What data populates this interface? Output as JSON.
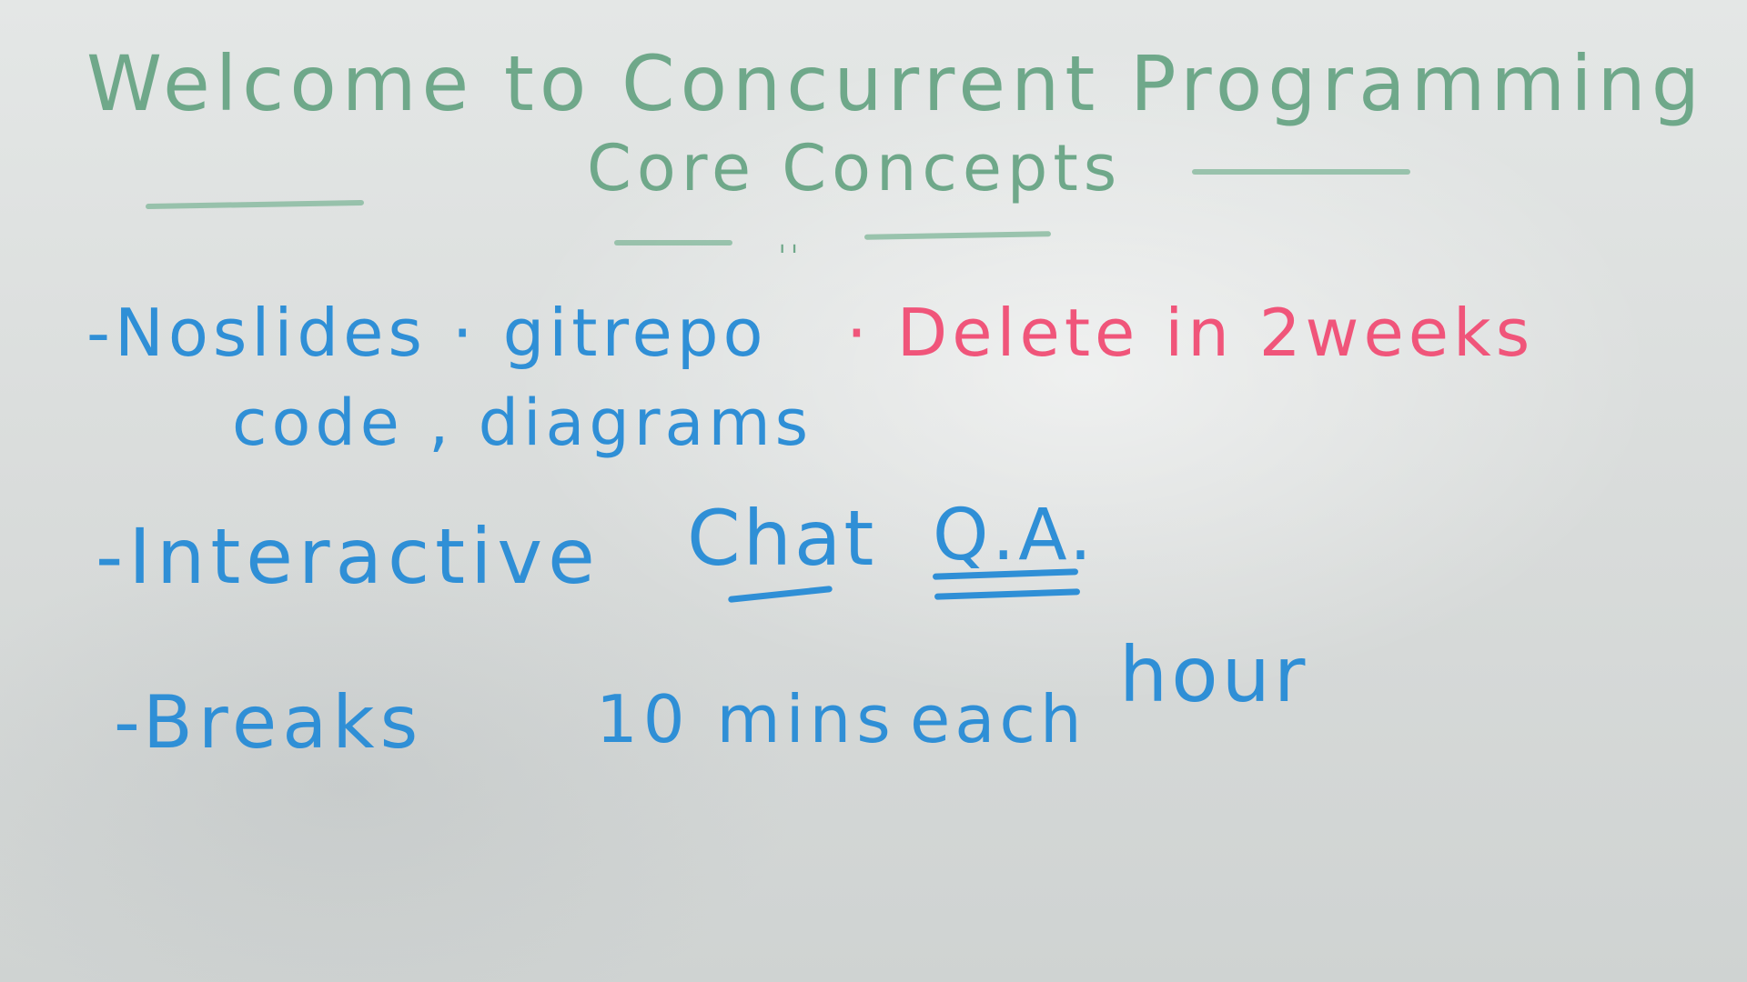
{
  "whiteboard": {
    "title_line1": "Welcome to Concurrent Programming",
    "title_line2": "Core Concepts",
    "title_marks": "ˌˌ",
    "items": [
      {
        "part1": "-Noslides · gitrepo",
        "part2": "· Delete in 2weeks",
        "part3": "code , diagrams"
      },
      {
        "part1": "-Interactive",
        "part2": "Chat",
        "part3": "Q.A."
      },
      {
        "part1": "-Breaks",
        "part2": "10 mins",
        "part3": "each",
        "part4": "hour"
      }
    ]
  },
  "colors": {
    "title_ink": "#6fa88a",
    "body_ink": "#2f8fd6",
    "highlight_ink": "#f0557a",
    "board": "#e2e5e4"
  }
}
